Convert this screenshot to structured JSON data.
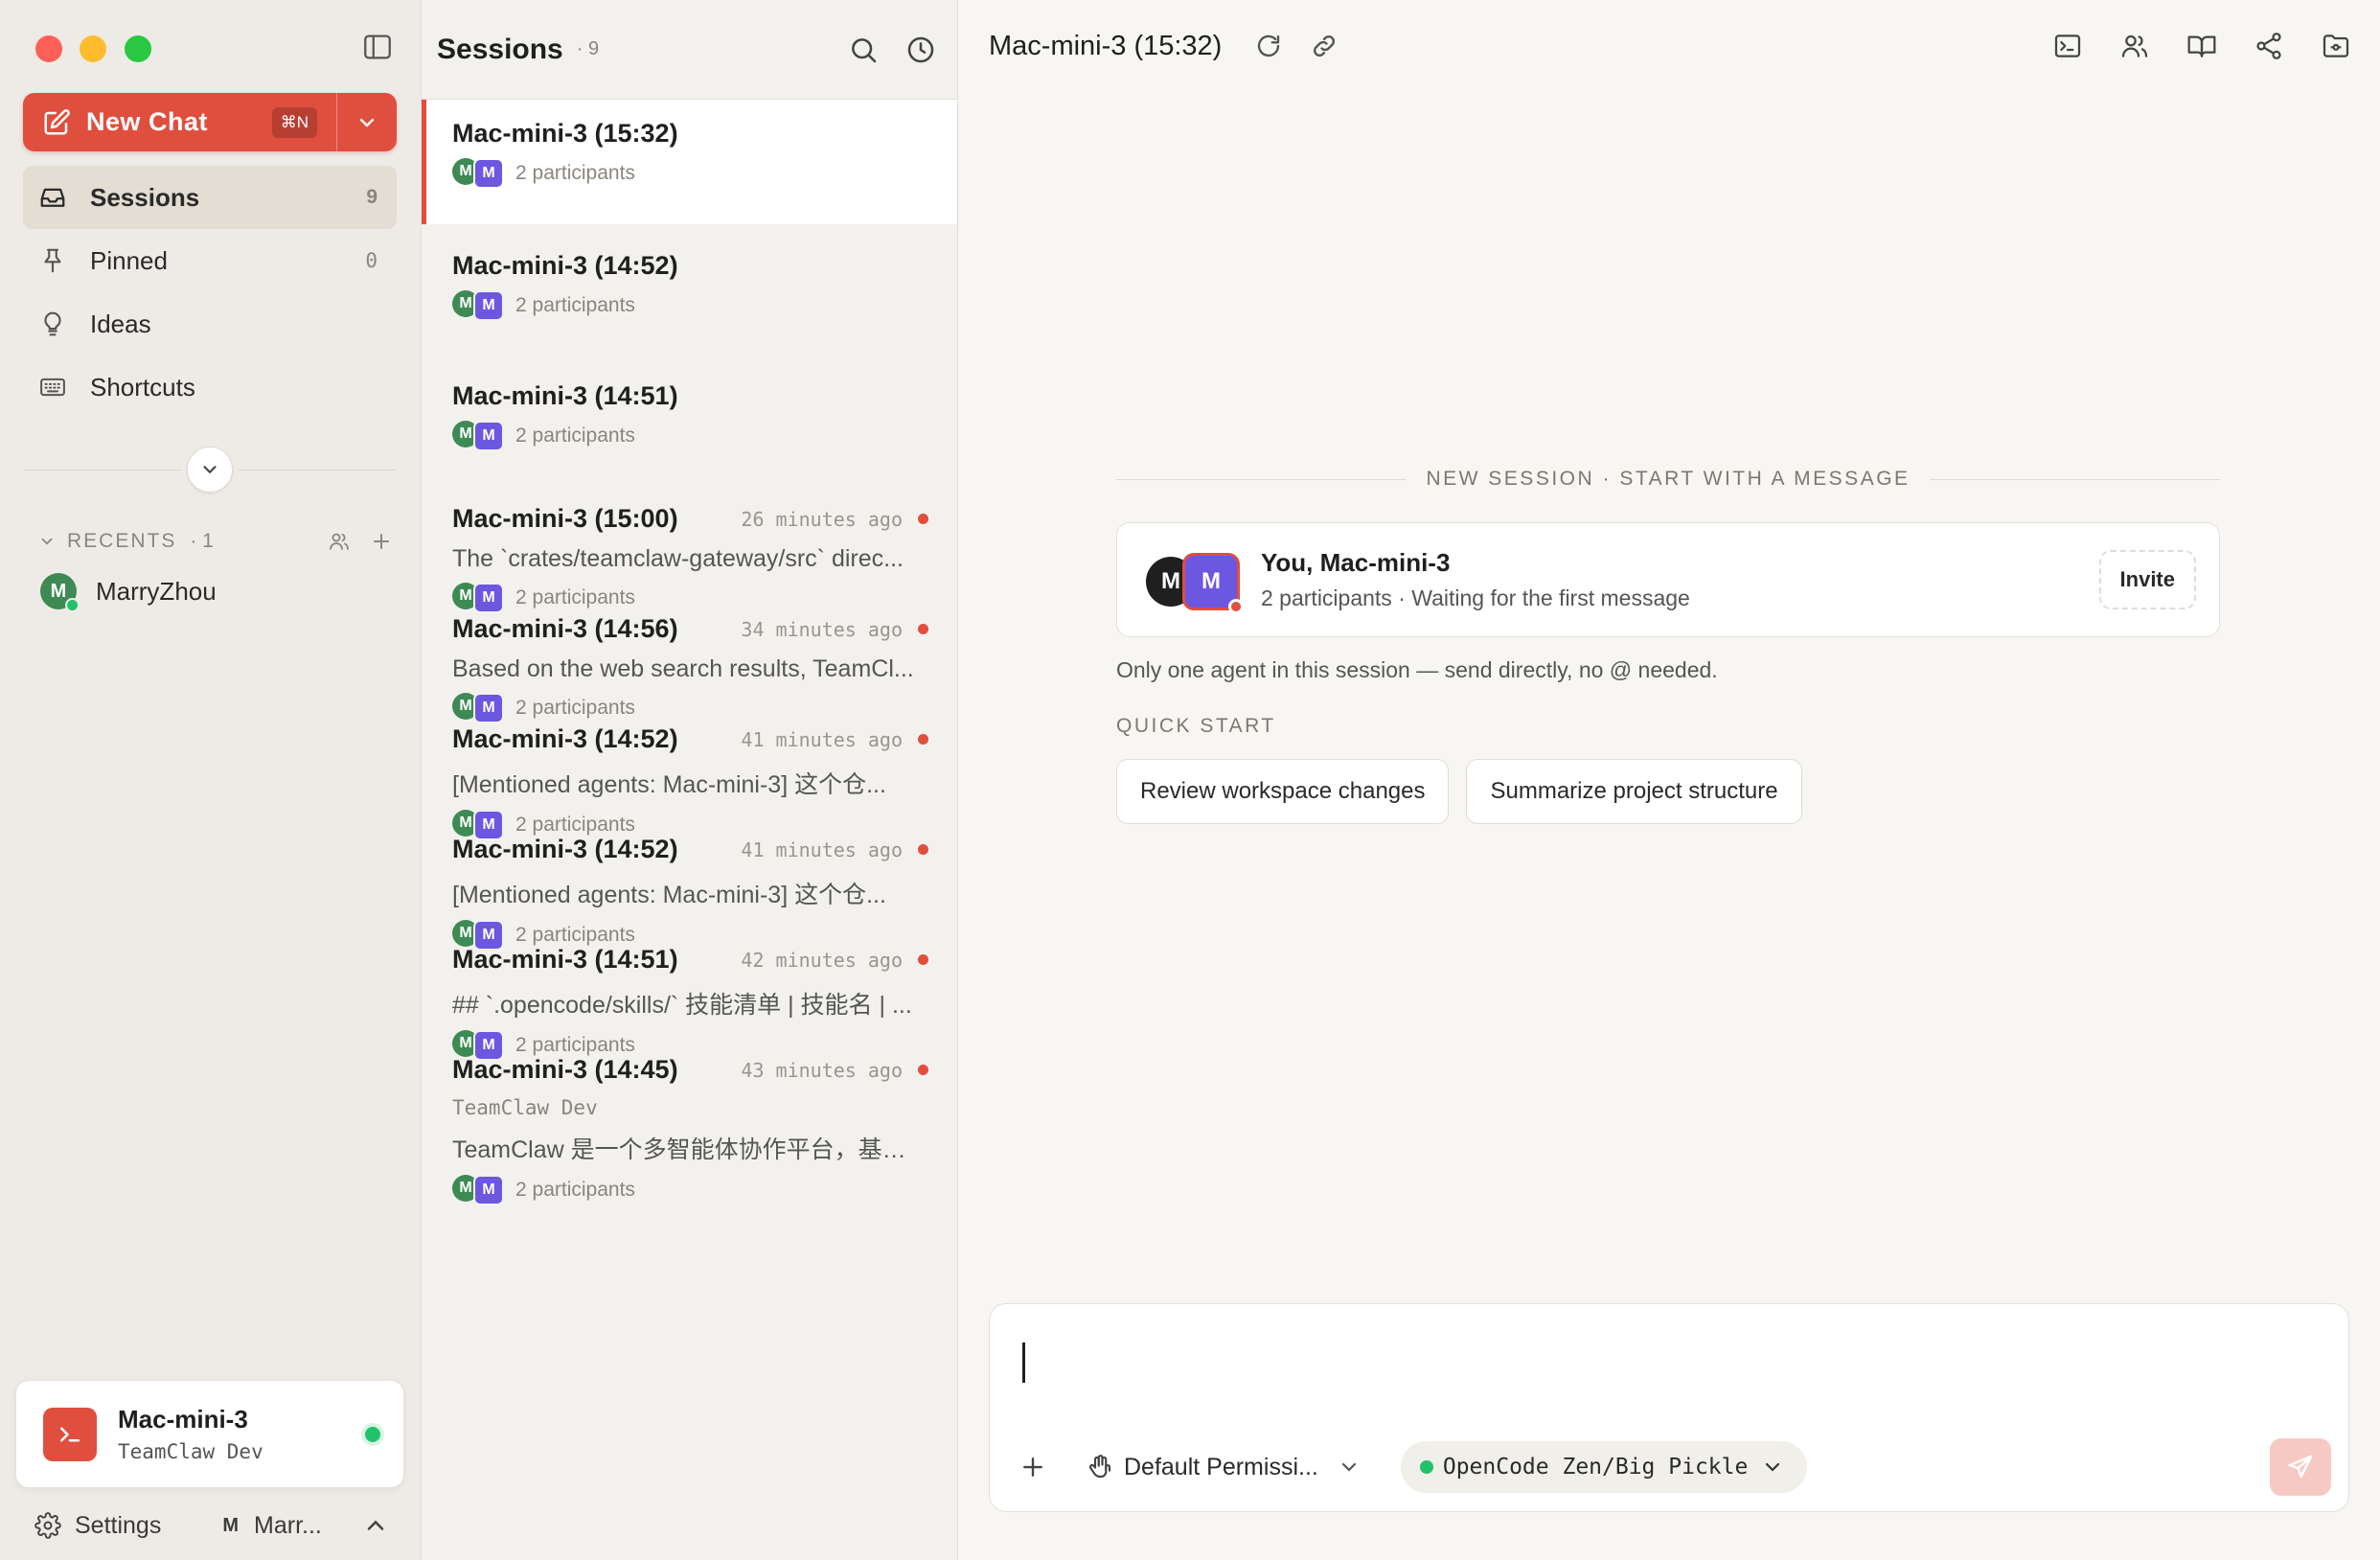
{
  "sidebar": {
    "new_chat_label": "New Chat",
    "new_chat_shortcut": "⌘N",
    "nav": [
      {
        "label": "Sessions",
        "count": "9"
      },
      {
        "label": "Pinned",
        "count": "0"
      },
      {
        "label": "Ideas",
        "count": ""
      },
      {
        "label": "Shortcuts",
        "count": ""
      }
    ],
    "recents_label": "RECENTS",
    "recents_count": "· 1",
    "recent_user": {
      "initial": "M",
      "name": "MarryZhou"
    },
    "device": {
      "name": "Mac-mini-3",
      "org": "TeamClaw Dev"
    },
    "footer": {
      "settings_label": "Settings",
      "user_initial": "M",
      "user_name": "Marr..."
    }
  },
  "sessions": {
    "title": "Sessions",
    "count": "· 9",
    "items": [
      {
        "name": "Mac-mini-3 (15:32)",
        "time": "",
        "preview": "",
        "org": "",
        "participants": "2 participants",
        "unread": false,
        "selected": true
      },
      {
        "name": "Mac-mini-3 (14:52)",
        "time": "",
        "preview": "",
        "org": "",
        "participants": "2 participants",
        "unread": false,
        "selected": false
      },
      {
        "name": "Mac-mini-3 (14:51)",
        "time": "",
        "preview": "",
        "org": "",
        "participants": "2 participants",
        "unread": false,
        "selected": false
      },
      {
        "name": "Mac-mini-3 (15:00)",
        "time": "26 minutes ago",
        "preview": "The `crates/teamclaw-gateway/src` direc...",
        "org": "",
        "participants": "2 participants",
        "unread": true,
        "selected": false
      },
      {
        "name": "Mac-mini-3 (14:56)",
        "time": "34 minutes ago",
        "preview": "Based on the web search results, TeamCl...",
        "org": "",
        "participants": "2 participants",
        "unread": true,
        "selected": false
      },
      {
        "name": "Mac-mini-3 (14:52)",
        "time": "41 minutes ago",
        "preview": "[Mentioned agents: Mac-mini-3] 这个仓...",
        "org": "",
        "participants": "2 participants",
        "unread": true,
        "selected": false
      },
      {
        "name": "Mac-mini-3 (14:52)",
        "time": "41 minutes ago",
        "preview": "[Mentioned agents: Mac-mini-3] 这个仓...",
        "org": "",
        "participants": "2 participants",
        "unread": true,
        "selected": false
      },
      {
        "name": "Mac-mini-3 (14:51)",
        "time": "42 minutes ago",
        "preview": "## `.opencode/skills/` 技能清单 | 技能名 | ...",
        "org": "",
        "participants": "2 participants",
        "unread": true,
        "selected": false
      },
      {
        "name": "Mac-mini-3 (14:45)",
        "time": "43 minutes ago",
        "preview": "TeamClaw 是一个多智能体协作平台，基于 ...",
        "org": "TeamClaw Dev",
        "participants": "2 participants",
        "unread": true,
        "selected": false
      }
    ]
  },
  "main": {
    "title": "Mac-mini-3 (15:32)",
    "divider_label": "NEW SESSION · START WITH A MESSAGE",
    "card": {
      "av1": "M",
      "av2": "M",
      "title": "You, Mac-mini-3",
      "subtitle": "2 participants · Waiting for the first message",
      "invite_label": "Invite"
    },
    "hint": "Only one agent in this session — send directly, no @ needed.",
    "quick_start_label": "QUICK START",
    "quick_start": [
      "Review workspace changes",
      "Summarize project structure"
    ],
    "composer": {
      "permission_label": "Default Permissi...",
      "model_label": "OpenCode Zen/Big Pickle"
    }
  },
  "colors": {
    "accent": "#e04e3e",
    "online": "#22c26a",
    "agent_purple": "#6c57e0",
    "user_green": "#3e8a55"
  }
}
